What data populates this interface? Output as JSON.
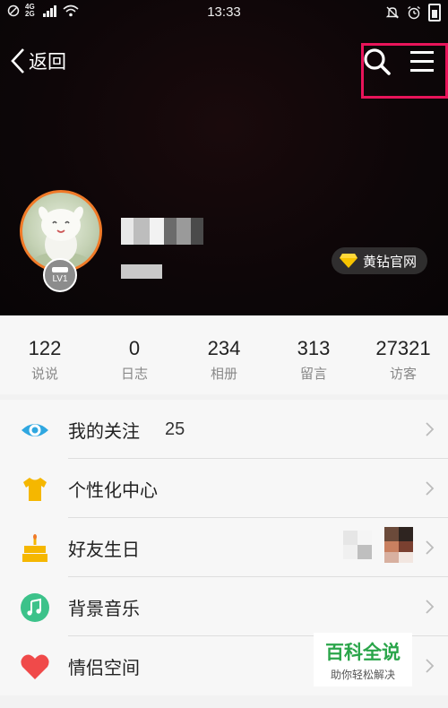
{
  "status_bar": {
    "network": "4G 2G",
    "time": "13:33"
  },
  "nav": {
    "back_label": "返回"
  },
  "vip_badge": {
    "label": "黄钻官网"
  },
  "avatar": {
    "level": "LV1"
  },
  "stats": [
    {
      "value": "122",
      "label": "说说"
    },
    {
      "value": "0",
      "label": "日志"
    },
    {
      "value": "234",
      "label": "相册"
    },
    {
      "value": "313",
      "label": "留言"
    },
    {
      "value": "27321",
      "label": "访客"
    }
  ],
  "menu": [
    {
      "label": "我的关注",
      "count": "25",
      "icon": "eye-icon",
      "color": "#2fa7e0"
    },
    {
      "label": "个性化中心",
      "icon": "tshirt-icon",
      "color": "#f5b700"
    },
    {
      "label": "好友生日",
      "icon": "cake-icon",
      "color": "#f5b700"
    },
    {
      "label": "背景音乐",
      "icon": "music-icon",
      "color": "#3cc28a"
    },
    {
      "label": "情侣空间",
      "icon": "heart-icon",
      "color": "#f04a4a"
    }
  ],
  "watermark": {
    "title": "百科全说",
    "subtitle": "助你轻松解决"
  }
}
